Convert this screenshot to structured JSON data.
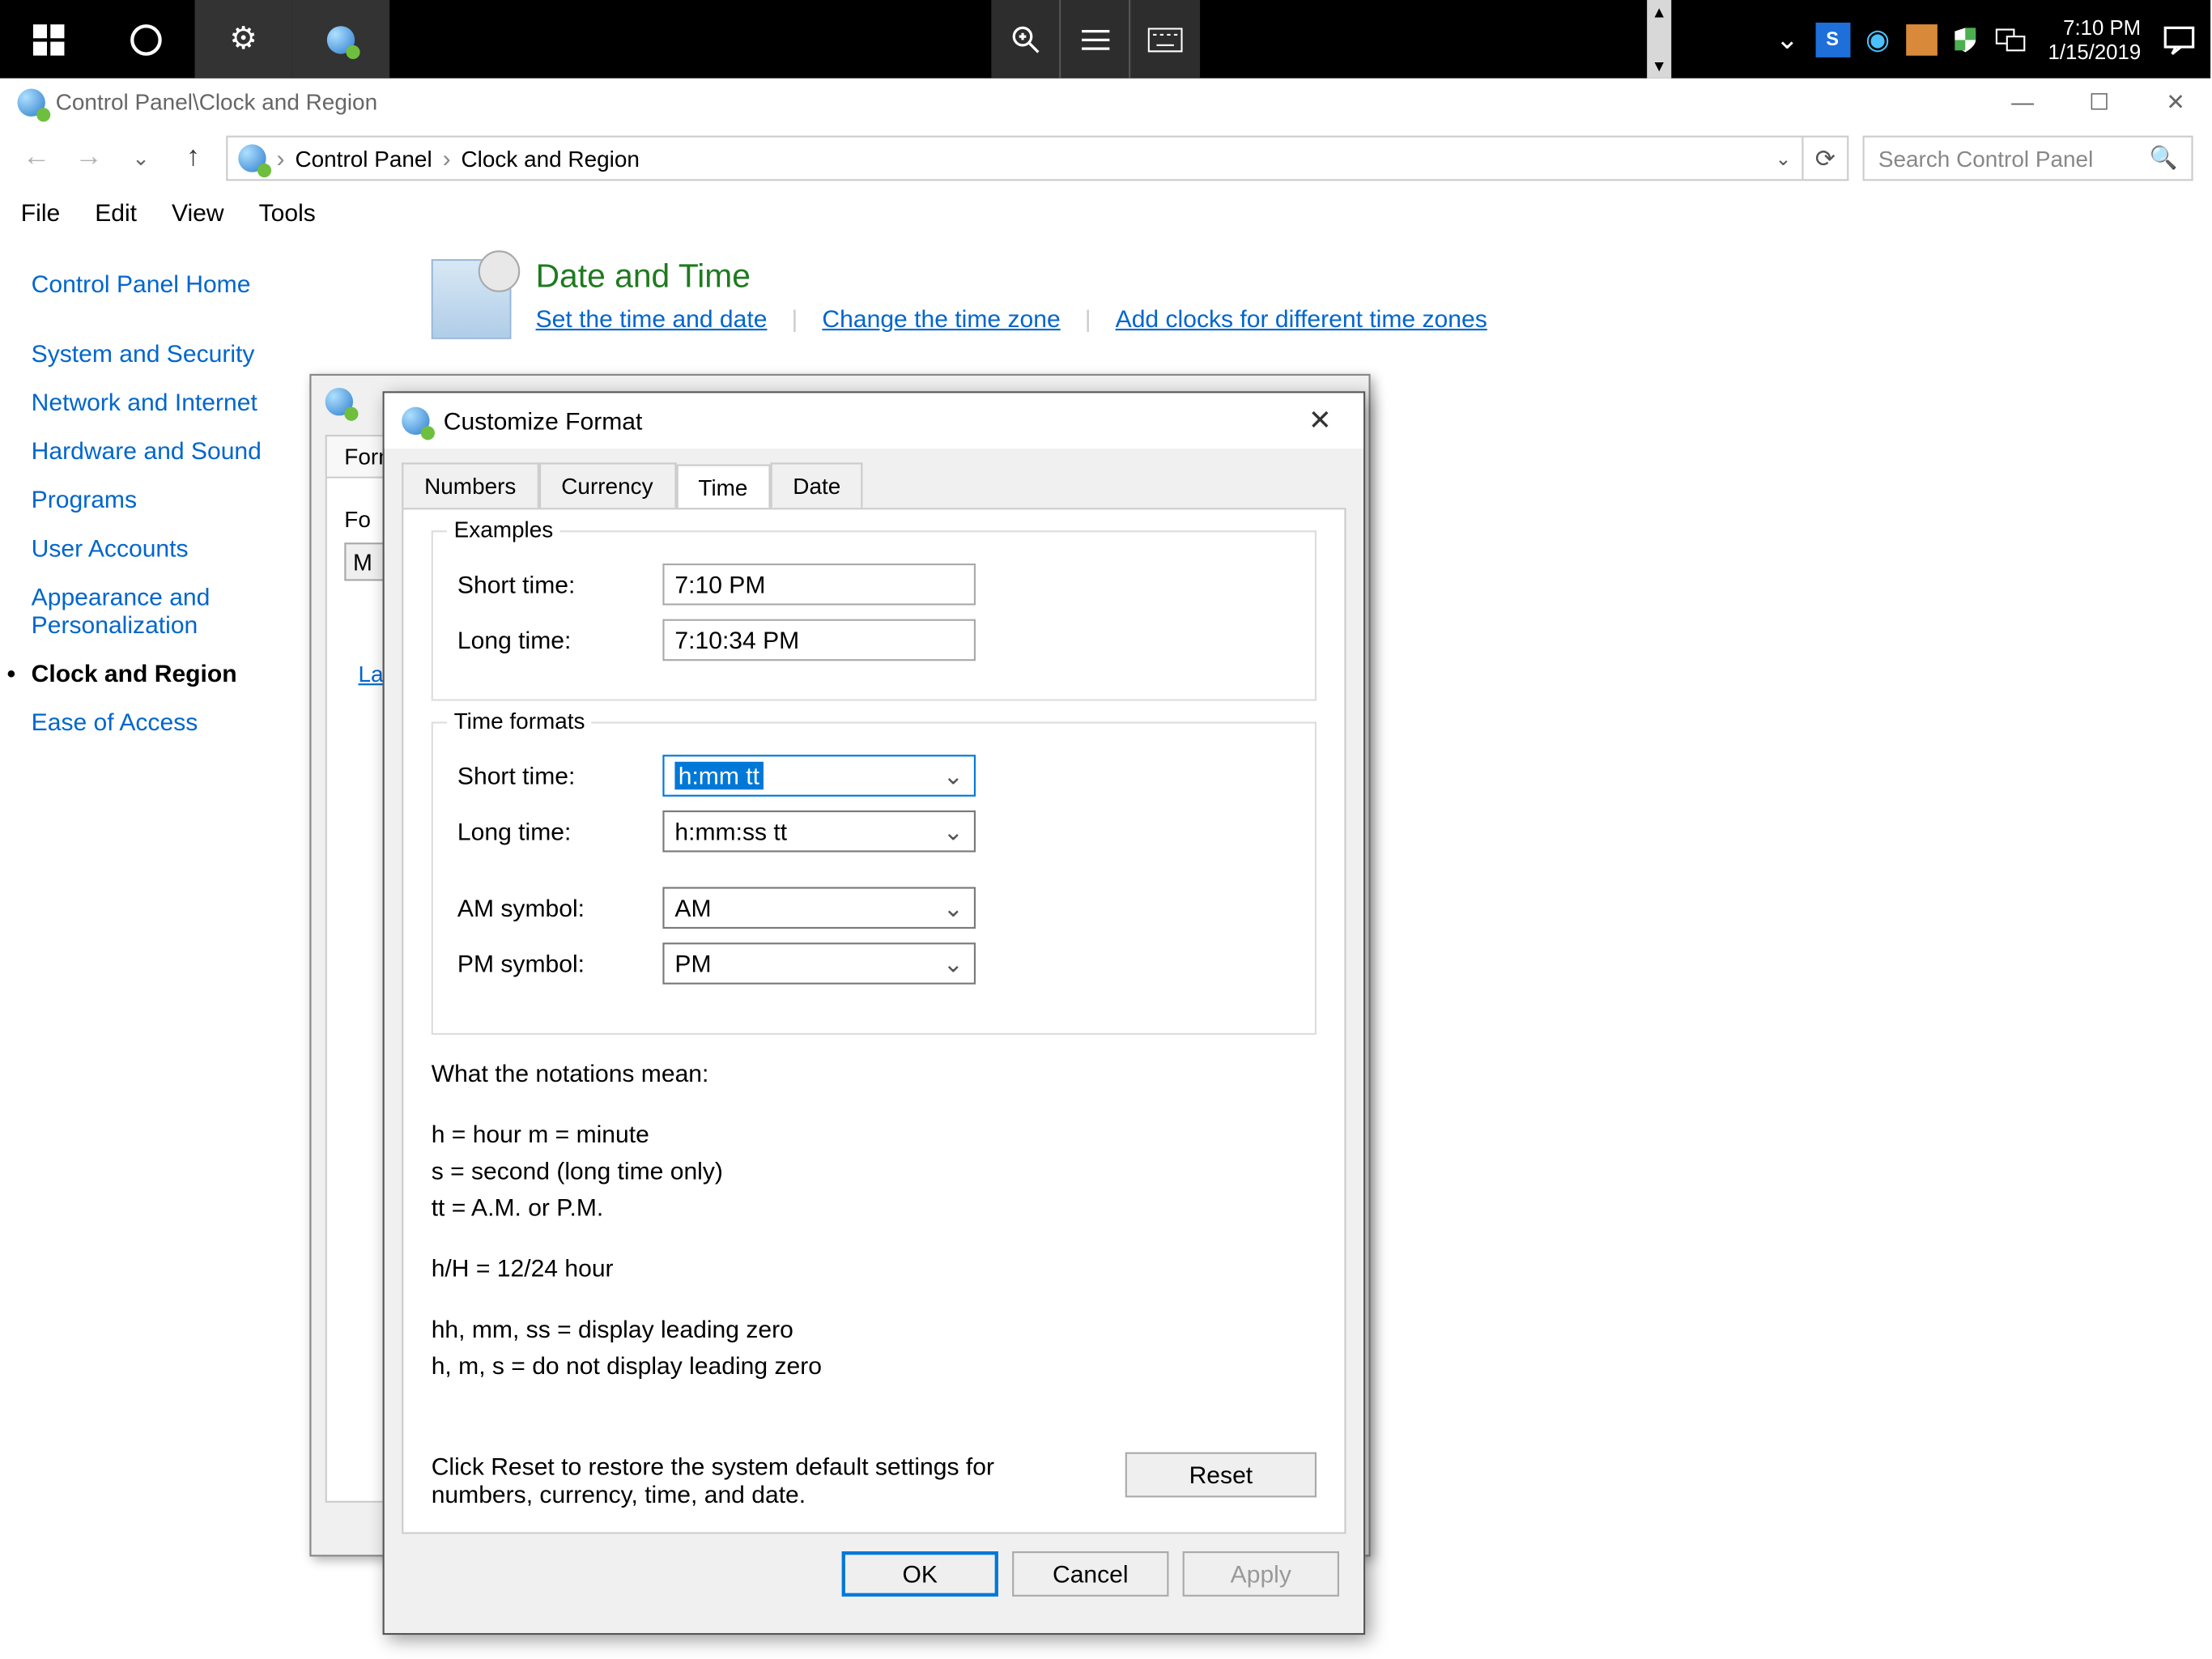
{
  "taskbar": {
    "time": "7:10 PM",
    "date": "1/15/2019"
  },
  "window": {
    "titlepath": "Control Panel\\Clock and Region",
    "breadcrumb": [
      "Control Panel",
      "Clock and Region"
    ],
    "search_placeholder": "Search Control Panel",
    "menu": [
      "File",
      "Edit",
      "View",
      "Tools"
    ]
  },
  "sidebar": {
    "items": [
      {
        "label": "Control Panel Home"
      },
      {
        "label": "System and Security"
      },
      {
        "label": "Network and Internet"
      },
      {
        "label": "Hardware and Sound"
      },
      {
        "label": "Programs"
      },
      {
        "label": "User Accounts"
      },
      {
        "label": "Appearance and Personalization"
      },
      {
        "label": "Clock and Region"
      },
      {
        "label": "Ease of Access"
      }
    ]
  },
  "category": {
    "title": "Date and Time",
    "links": [
      "Set the time and date",
      "Change the time zone",
      "Add clocks for different time zones"
    ]
  },
  "region_dialog": {
    "tabs_visible": "Formats",
    "format_label_short": "Fo",
    "dropdown_letter": "M",
    "la_link": "La"
  },
  "customize": {
    "title": "Customize Format",
    "tabs": [
      "Numbers",
      "Currency",
      "Time",
      "Date"
    ],
    "active_tab": "Time",
    "examples": {
      "legend": "Examples",
      "short_label": "Short time:",
      "short_value": "7:10 PM",
      "long_label": "Long time:",
      "long_value": "7:10:34 PM"
    },
    "formats": {
      "legend": "Time formats",
      "short_label": "Short time:",
      "short_value": "h:mm tt",
      "long_label": "Long time:",
      "long_value": "h:mm:ss tt",
      "am_label": "AM symbol:",
      "am_value": "AM",
      "pm_label": "PM symbol:",
      "pm_value": "PM"
    },
    "notations_heading": "What the notations mean:",
    "notations_line1": "h = hour   m = minute",
    "notations_line2": "s = second (long time only)",
    "notations_line3": "tt = A.M. or P.M.",
    "notations_line4": "h/H = 12/24 hour",
    "notations_line5": "hh, mm, ss = display leading zero",
    "notations_line6": "h, m, s = do not display leading zero",
    "reset_text": "Click Reset to restore the system default settings for numbers, currency, time, and date.",
    "reset_btn": "Reset",
    "ok": "OK",
    "cancel": "Cancel",
    "apply": "Apply"
  }
}
